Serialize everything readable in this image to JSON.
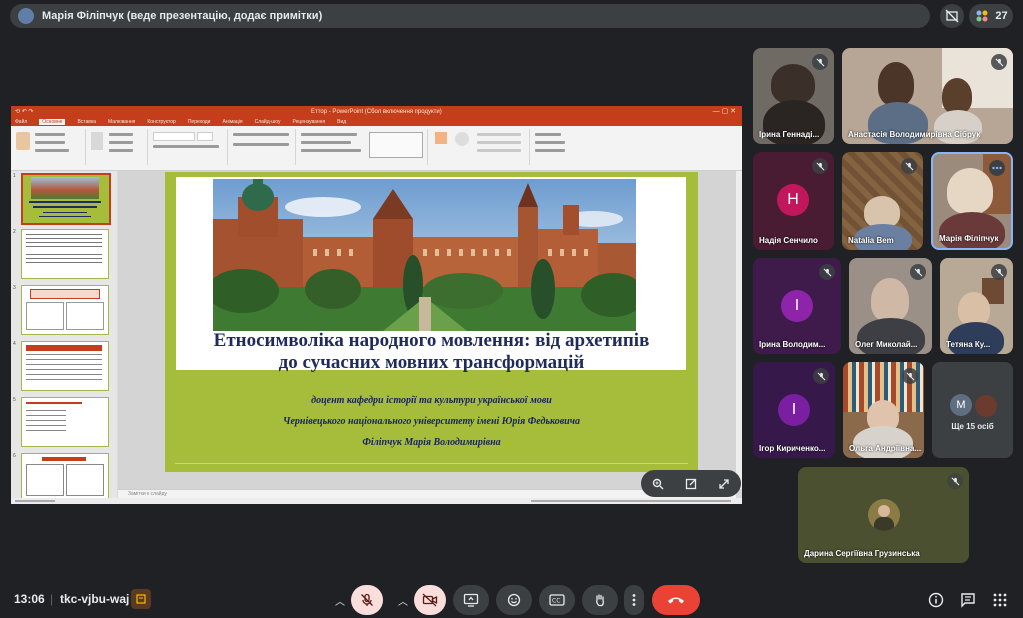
{
  "topbar": {
    "presenter_label": "Марія Філіпчук (веде презентацію, додає примітки)",
    "participants_count": "27"
  },
  "ppt": {
    "window_title": "Еттор - PowerPoint (Сбол включення продукти)",
    "tabs": [
      "Файл",
      "Основне",
      "Вставка",
      "Малювання",
      "Конструктор",
      "Переходи",
      "Анімація",
      "Слайд-шоу",
      "Рецензування",
      "Вид"
    ],
    "notes_placeholder": "Замітки к слайду",
    "slide": {
      "title_line1": "Етносимволіка народного мовлення: від архетипів",
      "title_line2": "до сучасних мовних  трансформацій",
      "sub1": "доцент кафедри історії  та культури української мови",
      "sub2": "Чернівецького національного університету імені Юрія Федьковича",
      "sub3": "Філіпчук Марія Володимирівна"
    },
    "thumb_numbers": [
      "1",
      "2",
      "3",
      "4",
      "5",
      "6"
    ]
  },
  "participants": [
    {
      "name": "Ірина Геннаді...",
      "type": "video"
    },
    {
      "name": "Анастасія Володимирівна Сібрук",
      "type": "video"
    },
    {
      "name": "Надія Сенчило",
      "type": "letter",
      "letter": "Н",
      "color": "#c2185b"
    },
    {
      "name": "Natalia Bem",
      "type": "video"
    },
    {
      "name": "Марія Філіпчук",
      "type": "video"
    },
    {
      "name": "Ірина Володим...",
      "type": "letter",
      "letter": "І",
      "color": "#8e24aa"
    },
    {
      "name": "Олег Миколай...",
      "type": "video"
    },
    {
      "name": "Тетяна Ку...",
      "type": "video"
    },
    {
      "name": "Ігор Кириченко...",
      "type": "letter",
      "letter": "І",
      "color": "#7b1fa2"
    },
    {
      "name": "Ольга Андріївна...",
      "type": "video"
    },
    {
      "name": "Дарина Сергіївна Грузинська",
      "type": "video"
    }
  ],
  "more_tile": {
    "label": "Ще 15 осіб",
    "avatar_letter": "M"
  },
  "bottombar": {
    "time": "13:06",
    "meeting_code": "tkc-vjbu-waj"
  },
  "colors": {
    "background": "#202124",
    "ppt_accent": "#c43e1c",
    "slide_green": "#a6bd3b",
    "end_call": "#ea4335"
  }
}
